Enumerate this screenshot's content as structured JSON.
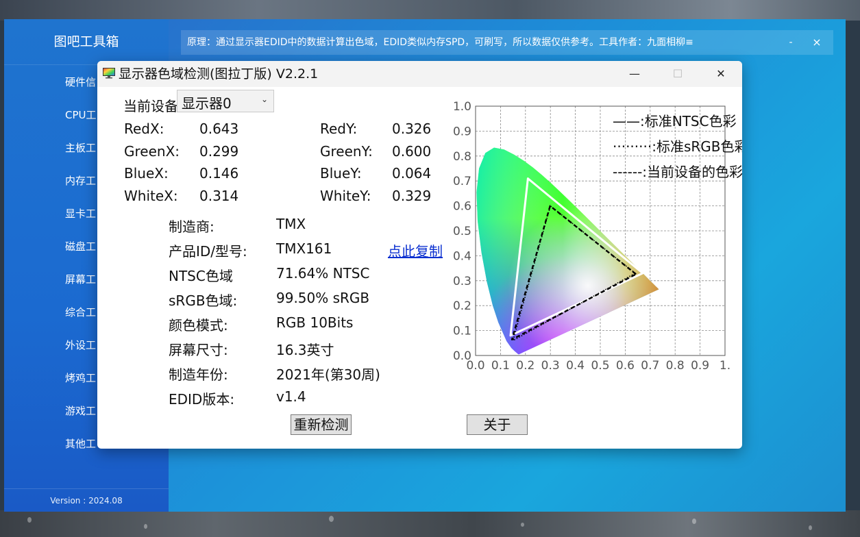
{
  "app": {
    "title": "图吧工具箱",
    "version": "Version : 2024.08",
    "info_text": "原理：通过显示器EDID中的数据计算出色域，EDID类似内存SPD，可刷写，所以数据仅供参考。工具作者：九面相柳≡",
    "info_min": "-",
    "info_close": "×"
  },
  "sidebar": {
    "items": [
      {
        "label": "硬件信"
      },
      {
        "label": "CPU工"
      },
      {
        "label": "主板工"
      },
      {
        "label": "内存工"
      },
      {
        "label": "显卡工"
      },
      {
        "label": "磁盘工"
      },
      {
        "label": "屏幕工"
      },
      {
        "label": "综合工"
      },
      {
        "label": "外设工"
      },
      {
        "label": "烤鸡工"
      },
      {
        "label": "游戏工"
      },
      {
        "label": "其他工"
      }
    ]
  },
  "dialog": {
    "title": "显示器色域检测(图拉丁版) V2.2.1",
    "minimize": "—",
    "maximize": "☐",
    "close": "✕",
    "device_label": "当前设备",
    "device_value": "显示器0",
    "coords": {
      "red_x_label": "RedX:",
      "red_x": "0.643",
      "red_y_label": "RedY:",
      "red_y": "0.326",
      "green_x_label": "GreenX:",
      "green_x": "0.299",
      "green_y_label": "GreenY:",
      "green_y": "0.600",
      "blue_x_label": "BlueX:",
      "blue_x": "0.146",
      "blue_y_label": "BlueY:",
      "blue_y": "0.064",
      "white_x_label": "WhiteX:",
      "white_x": "0.314",
      "white_y_label": "WhiteY:",
      "white_y": "0.329"
    },
    "info": [
      {
        "label": "制造商:",
        "value": "TMX"
      },
      {
        "label": "产品ID/型号:",
        "value": "TMX161"
      },
      {
        "label": "NTSC色域",
        "value": "71.64% NTSC"
      },
      {
        "label": "sRGB色域:",
        "value": "99.50% sRGB"
      },
      {
        "label": "颜色模式:",
        "value": "RGB 10Bits"
      },
      {
        "label": "屏幕尺寸:",
        "value": "16.3英寸"
      },
      {
        "label": "制造年份:",
        "value": "2021年(第30周)"
      },
      {
        "label": "EDID版本:",
        "value": "v1.4"
      }
    ],
    "copy_link": "点此复制",
    "redetect_button": "重新检测",
    "about_button": "关于"
  },
  "chart_data": {
    "type": "scatter",
    "title": "",
    "xlabel": "",
    "ylabel": "",
    "xlim": [
      0.0,
      1.0
    ],
    "ylim": [
      0.0,
      1.0
    ],
    "x_ticks": [
      "0.0",
      "0.1",
      "0.2",
      "0.3",
      "0.4",
      "0.5",
      "0.6",
      "0.7",
      "0.8",
      "0.9",
      "1."
    ],
    "y_ticks": [
      "0.0",
      "0.1",
      "0.2",
      "0.3",
      "0.4",
      "0.5",
      "0.6",
      "0.7",
      "0.8",
      "0.9",
      "1.0"
    ],
    "grid": true,
    "legend_position": "top-right",
    "legend": [
      {
        "sample": "——",
        "label": ":标准NTSC色彩"
      },
      {
        "sample": "·········",
        "label": ":标准sRGB色彩"
      },
      {
        "sample": "------",
        "label": ":当前设备的色彩"
      }
    ],
    "series": [
      {
        "name": "标准NTSC色彩",
        "style": "solid",
        "color": "#ffffff",
        "points": [
          [
            0.67,
            0.33
          ],
          [
            0.21,
            0.71
          ],
          [
            0.14,
            0.08
          ]
        ]
      },
      {
        "name": "标准sRGB色彩",
        "style": "dotted",
        "color": "#000000",
        "points": [
          [
            0.64,
            0.33
          ],
          [
            0.3,
            0.6
          ],
          [
            0.15,
            0.06
          ]
        ]
      },
      {
        "name": "当前设备的色彩",
        "style": "dashed",
        "color": "#000000",
        "points": [
          [
            0.643,
            0.326
          ],
          [
            0.299,
            0.6
          ],
          [
            0.146,
            0.064
          ]
        ]
      }
    ]
  }
}
